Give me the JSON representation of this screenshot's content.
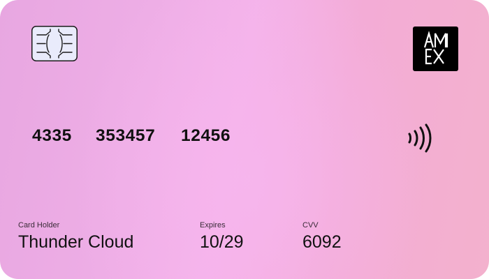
{
  "card": {
    "number_groups": [
      "4335",
      "353457",
      "12456"
    ],
    "holder": {
      "label": "Card Holder",
      "value": "Thunder Cloud"
    },
    "expires": {
      "label": "Expires",
      "value": "10/29"
    },
    "cvv": {
      "label": "CVV",
      "value": "6092"
    },
    "logo": {
      "icon": "amex-logo",
      "text_top": "AM",
      "text_bottom": "EX"
    },
    "chip_icon": "chip-icon",
    "contactless_icon": "contactless-icon"
  },
  "colors": {
    "gradient_left": "#e8a7e1",
    "gradient_center": "#f4b3ea",
    "gradient_right": "#f3b1cd",
    "text": "#111111",
    "logo_bg": "#000000",
    "chip_fill": "#e9ebfb"
  }
}
